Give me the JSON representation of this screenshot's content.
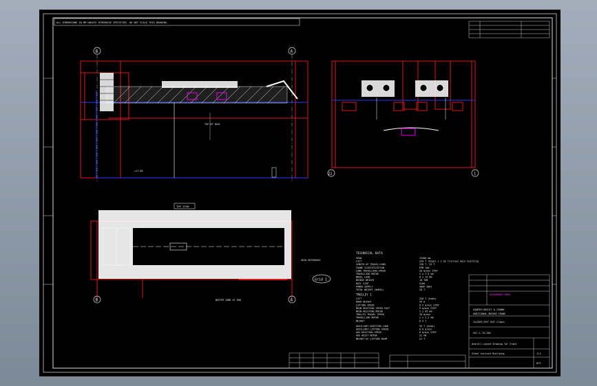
{
  "drawing": {
    "grid_labels": {
      "b1": "B",
      "a1": "A",
      "b2": "B",
      "a2": "A",
      "c_left": "22",
      "c_right": "1"
    },
    "grid_callout": "Grid 1",
    "top_view_label": "TOP VIEW",
    "technical_data": {
      "title": "TECHNICAL DATA",
      "rows": [
        {
          "k": "SPAN",
          "v": "22500 mm"
        },
        {
          "k": "LIFT",
          "v": "220 T (hook) x 2 by trolleys main hoisting"
        },
        {
          "k": "LENGTH OF TRAVEL/LONG",
          "v": "220 T, 55 T"
        },
        {
          "k": "CRANE CLASSIFICATION",
          "v": "FEM 1Am"
        },
        {
          "k": "LONG TRAVELLING SPEED",
          "v": "20 m/min  STEP"
        },
        {
          "k": "TRAVELLING MOTOR",
          "v": "2 x 7.5 kW"
        },
        {
          "k": "WHEEL LOAD",
          "v": "8 x 15 KN"
        },
        {
          "k": "BRIDGE WEIGHT",
          "v": "18 TON"
        },
        {
          "k": "RAIL SIZE",
          "v": "A100"
        },
        {
          "k": "POWER SUPPLY",
          "v": "400V 50Hz"
        },
        {
          "k": "TOTAL WEIGHT (WHEEL)",
          "v": "26 T"
        }
      ],
      "trolley_title": "TROLLEY 1",
      "trolley_rows": [
        {
          "k": "LIFT",
          "v": "220 T  (hook)"
        },
        {
          "k": "HOOK HEIGHT",
          "v": "20 m"
        },
        {
          "k": "LIFTING SPEED",
          "v": "0.5 m/min  STEP"
        },
        {
          "k": "MAIN HOISTING SPEED  FAST",
          "v": "5 m/min  STEP"
        },
        {
          "k": "MAIN HOISTING MOTOR",
          "v": "2 x 45 kW"
        },
        {
          "k": "TROLLEY TRAVEL SPEED",
          "v": "20 m/min"
        },
        {
          "k": "TRAVELLING MOTOR",
          "v": "2 x 2.2 kW"
        },
        {
          "k": "WEIGHT",
          "v": "8.5 T"
        }
      ],
      "aux_rows": [
        {
          "k": "AUXILIARY HOISTING LOAD",
          "v": "55 T  (hook)"
        },
        {
          "k": "AUXILIARY LIFTING SPEED",
          "v": "0.8 m/min"
        },
        {
          "k": "AUX HOISTING SPEED",
          "v": "6 m/min  STEP"
        },
        {
          "k": "AUX HOIST MOTOR",
          "v": "22 kW"
        },
        {
          "k": "WEIGHT OF LIFTING BEAM",
          "v": "22 T"
        }
      ]
    },
    "title_block": {
      "company_1": "GANTRY/HOIST & CRANE",
      "company_2": "ADDITIONAL BRIDGE CRANE",
      "project": "Steel Lecture Building",
      "crane": "2x220T/55T EOT Crane",
      "drawing_title": "Overall Layout Drawing for Crane",
      "doc_no": "SSC-1-TX-202",
      "sheet": "1/1",
      "scale": "NTS",
      "highlight": "HAZARDOUS AREA"
    },
    "notes": "ALL DIMENSIONS IN MM UNLESS OTHERWISE SPECIFIED. DO NOT SCALE THIS DRAWING."
  }
}
